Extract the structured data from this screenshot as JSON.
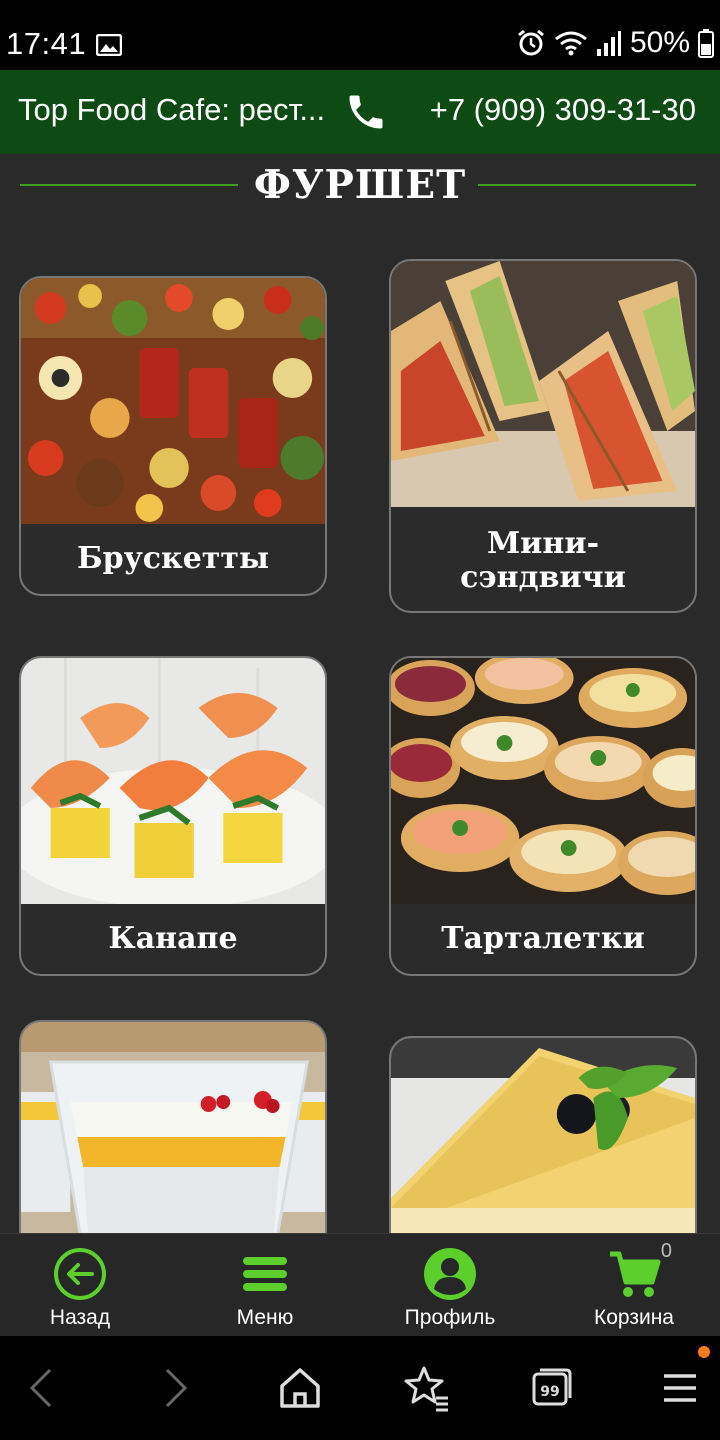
{
  "status_bar": {
    "time": "17:41",
    "battery": "50%"
  },
  "header": {
    "title": "Top Food Cafe: рест...",
    "phone": "+7 (909) 309-31-30"
  },
  "section": {
    "title": "ФУРШЕТ"
  },
  "cards": [
    {
      "label": "Брускетты"
    },
    {
      "label": "Мини-",
      "label2": "сэндвичи"
    },
    {
      "label": "Канапе"
    },
    {
      "label": "Тарталетки"
    },
    {
      "label": ""
    },
    {
      "label": ""
    }
  ],
  "bottom_nav": {
    "back": "Назад",
    "menu": "Меню",
    "profile": "Профиль",
    "cart": "Корзина",
    "cart_count": "0"
  },
  "colors": {
    "accent": "#5ccf2c",
    "header_bg": "#0e4a14",
    "page_bg": "#2a2a2a"
  }
}
